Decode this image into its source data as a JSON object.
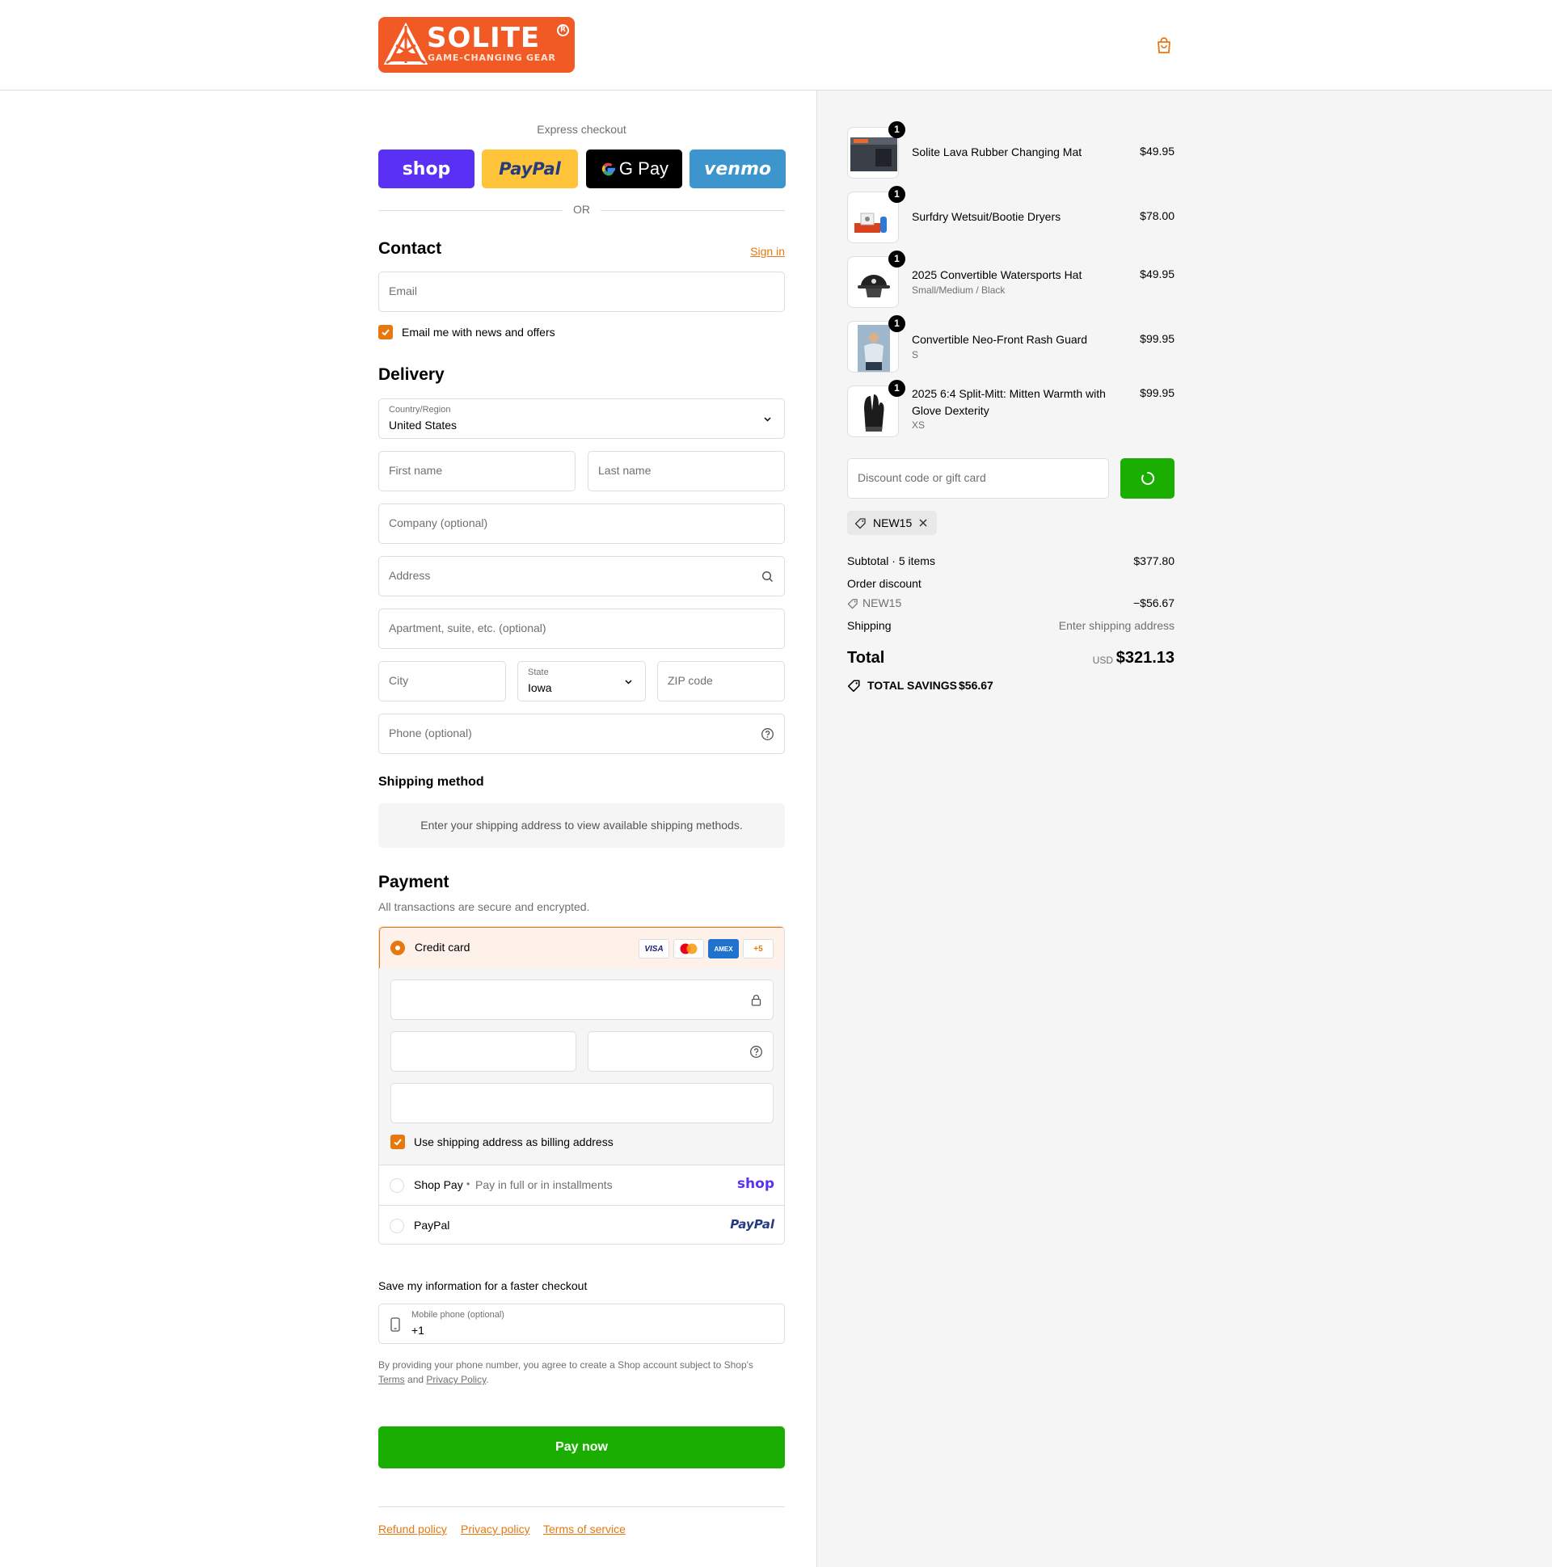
{
  "brand": {
    "name": "SOLITE",
    "tagline": "GAME-CHANGING GEAR",
    "reg": "R",
    "color": "#f15a24",
    "accent": "#e7780d"
  },
  "header": {
    "cart_icon": "shopping-bag-icon"
  },
  "express": {
    "title": "Express checkout",
    "buttons": [
      {
        "label": "shop",
        "color": "#5a31f4"
      },
      {
        "label": "PayPal",
        "color": "#ffc439"
      },
      {
        "label": "G Pay",
        "color": "#000000"
      },
      {
        "label": "venmo",
        "color": "#3d95ce"
      }
    ],
    "or": "OR"
  },
  "contact": {
    "title": "Contact",
    "sign_in": "Sign in",
    "email_placeholder": "Email",
    "news_label": "Email me with news and offers",
    "news_checked": true
  },
  "delivery": {
    "title": "Delivery",
    "country_label": "Country/Region",
    "country_value": "United States",
    "first_name": "First name",
    "last_name": "Last name",
    "company": "Company (optional)",
    "address": "Address",
    "apartment": "Apartment, suite, etc. (optional)",
    "city": "City",
    "state_label": "State",
    "state_value": "Iowa",
    "zip": "ZIP code",
    "phone": "Phone (optional)"
  },
  "shipping_method": {
    "title": "Shipping method",
    "message": "Enter your shipping address to view available shipping methods."
  },
  "payment": {
    "title": "Payment",
    "subtitle": "All transactions are secure and encrypted.",
    "credit_card": "Credit card",
    "card_logos": [
      "VISA",
      "Mastercard",
      "AMEX",
      "+5"
    ],
    "billing_label": "Use shipping address as billing address",
    "billing_checked": true,
    "shop_pay": "Shop Pay",
    "shop_pay_sep": "•",
    "shop_pay_desc": "Pay in full or in installments",
    "shop_pay_logo": "shop",
    "paypal": "PayPal",
    "paypal_logo": "PayPal"
  },
  "save_info": {
    "title": "Save my information for a faster checkout",
    "mobile_label": "Mobile phone (optional)",
    "mobile_value": "+1",
    "legal_1": "By providing your phone number, you agree to create a Shop account subject to Shop's",
    "terms": "Terms",
    "and": "and",
    "privacy": "Privacy Policy",
    "period": "."
  },
  "pay_now": "Pay now",
  "footer": {
    "links": [
      "Refund policy",
      "Privacy policy",
      "Terms of service"
    ]
  },
  "summary": {
    "items": [
      {
        "name": "Solite Lava Rubber Changing Mat",
        "variant": "",
        "price": "$49.95",
        "qty": "1"
      },
      {
        "name": "Surfdry Wetsuit/Bootie Dryers",
        "variant": "",
        "price": "$78.00",
        "qty": "1"
      },
      {
        "name": "2025 Convertible Watersports Hat",
        "variant": "Small/Medium / Black",
        "price": "$49.95",
        "qty": "1"
      },
      {
        "name": "Convertible Neo-Front Rash Guard",
        "variant": "S",
        "price": "$99.95",
        "qty": "1"
      },
      {
        "name": "2025 6:4 Split-Mitt: Mitten Warmth with Glove Dexterity",
        "variant": "XS",
        "price": "$99.95",
        "qty": "1"
      }
    ],
    "discount_placeholder": "Discount code or gift card",
    "applied_code": "NEW15",
    "subtotal_label": "Subtotal · 5 items",
    "subtotal_value": "$377.80",
    "order_discount_label": "Order discount",
    "order_discount_code": "NEW15",
    "order_discount_value": "−$56.67",
    "shipping_label": "Shipping",
    "shipping_value": "Enter shipping address",
    "total_label": "Total",
    "currency": "USD",
    "total_value": "$321.13",
    "savings_label": "TOTAL SAVINGS",
    "savings_value": "$56.67"
  }
}
